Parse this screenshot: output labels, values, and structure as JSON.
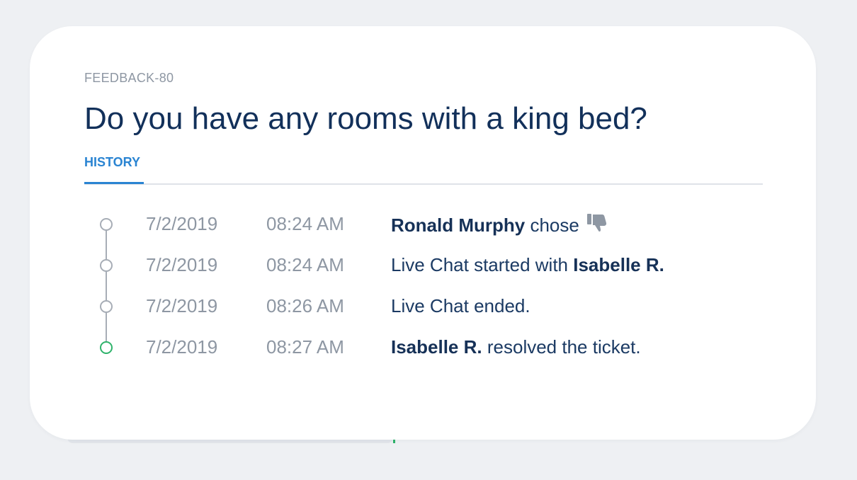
{
  "ticket": {
    "id": "FEEDBACK-80",
    "title": "Do you have any rooms with a king bed?"
  },
  "tabs": [
    {
      "label": "HISTORY",
      "active": true
    }
  ],
  "history": [
    {
      "date": "7/2/2019",
      "time": "08:24 AM",
      "actor": "Ronald Murphy",
      "action": "chose",
      "icon": "thumbs-down-icon",
      "status": "done"
    },
    {
      "date": "7/2/2019",
      "time": "08:24 AM",
      "action": "Live Chat started with",
      "actor": "Isabelle R.",
      "status": "done"
    },
    {
      "date": "7/2/2019",
      "time": "08:26 AM",
      "action": "Live Chat ended.",
      "status": "done"
    },
    {
      "date": "7/2/2019",
      "time": "08:27 AM",
      "actor": "Isabelle R.",
      "action": "resolved the ticket.",
      "status": "resolved"
    }
  ],
  "colors": {
    "background": "#eef0f3",
    "title": "#12305a",
    "accent": "#2a84d2",
    "muted": "#8e97a3",
    "resolved": "#2fb36b",
    "timeline": "#a7adb6"
  }
}
